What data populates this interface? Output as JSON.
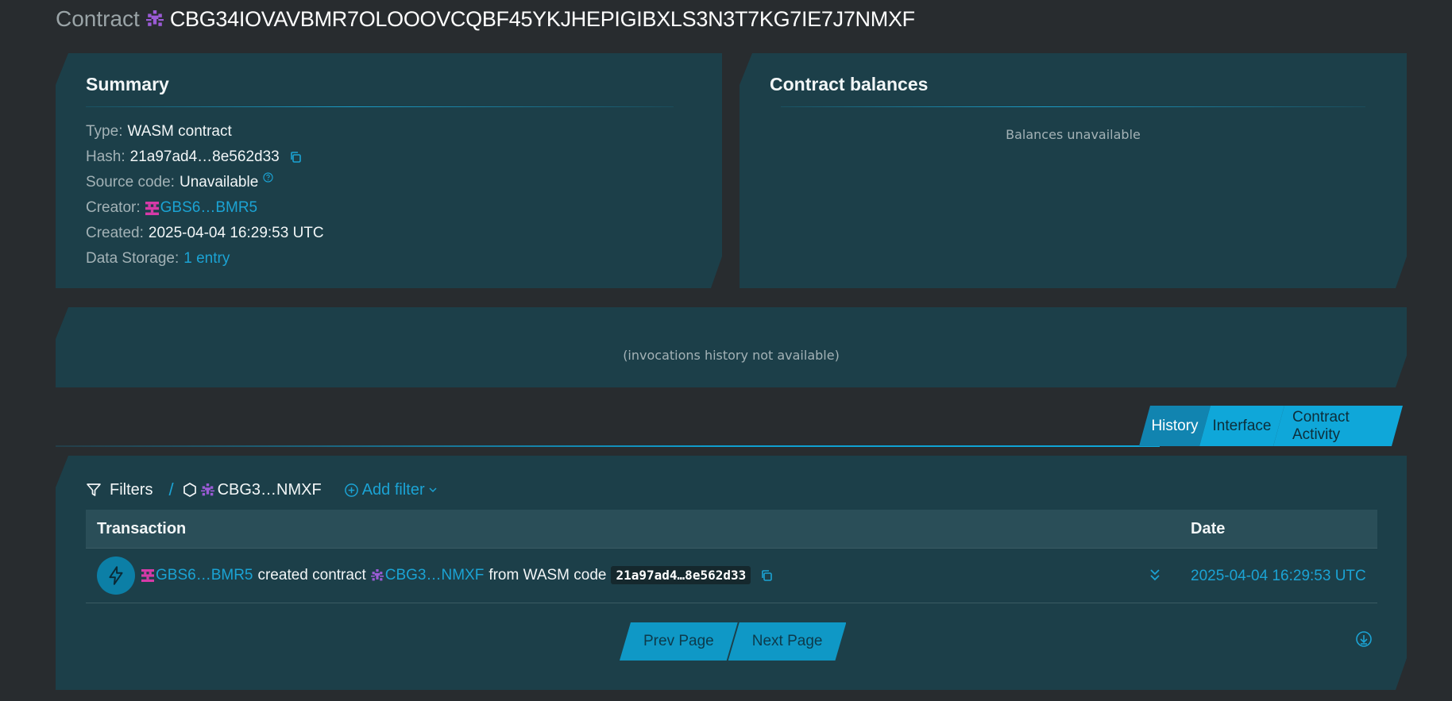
{
  "header": {
    "label": "Contract",
    "address": "CBG34IOVAVBMR7OLOOOVCQBF45YKJHEPIGIBXLS3N3T7KG7IE7J7NMXF"
  },
  "summary": {
    "title": "Summary",
    "type_label": "Type:",
    "type_value": "WASM contract",
    "hash_label": "Hash:",
    "hash_value": "21a97ad4…8e562d33",
    "source_label": "Source code:",
    "source_value": "Unavailable",
    "creator_label": "Creator:",
    "creator_value": "GBS6…BMR5",
    "created_label": "Created:",
    "created_value": "2025-04-04 16:29:53 UTC",
    "storage_label": "Data Storage:",
    "storage_value": "1 entry"
  },
  "balances": {
    "title": "Contract balances",
    "empty": "Balances unavailable"
  },
  "invocations": {
    "empty": "(invocations history not available)"
  },
  "tabs": [
    {
      "label": "History",
      "active": true
    },
    {
      "label": "Interface",
      "active": false
    },
    {
      "label": "Contract Activity",
      "active": false
    }
  ],
  "filters": {
    "label": "Filters",
    "separator": "/",
    "active_filter": "CBG3…NMXF",
    "add_label": "Add filter"
  },
  "table": {
    "col_transaction": "Transaction",
    "col_date": "Date",
    "rows": [
      {
        "source": "GBS6…BMR5",
        "action": "created contract",
        "contract": "CBG3…NMXF",
        "from_text": "from WASM code",
        "code_hash": "21a97ad4…8e562d33",
        "date": "2025-04-04 16:29:53 UTC"
      }
    ]
  },
  "pager": {
    "prev": "Prev Page",
    "next": "Next Page"
  },
  "colors": {
    "background": "#282c2f",
    "panel": "#1c3f49",
    "accent": "#0fa7d9",
    "link": "#1ba3d4",
    "creator_avatar": "#d63aa8",
    "contract_avatar": "#9b5bd6"
  }
}
